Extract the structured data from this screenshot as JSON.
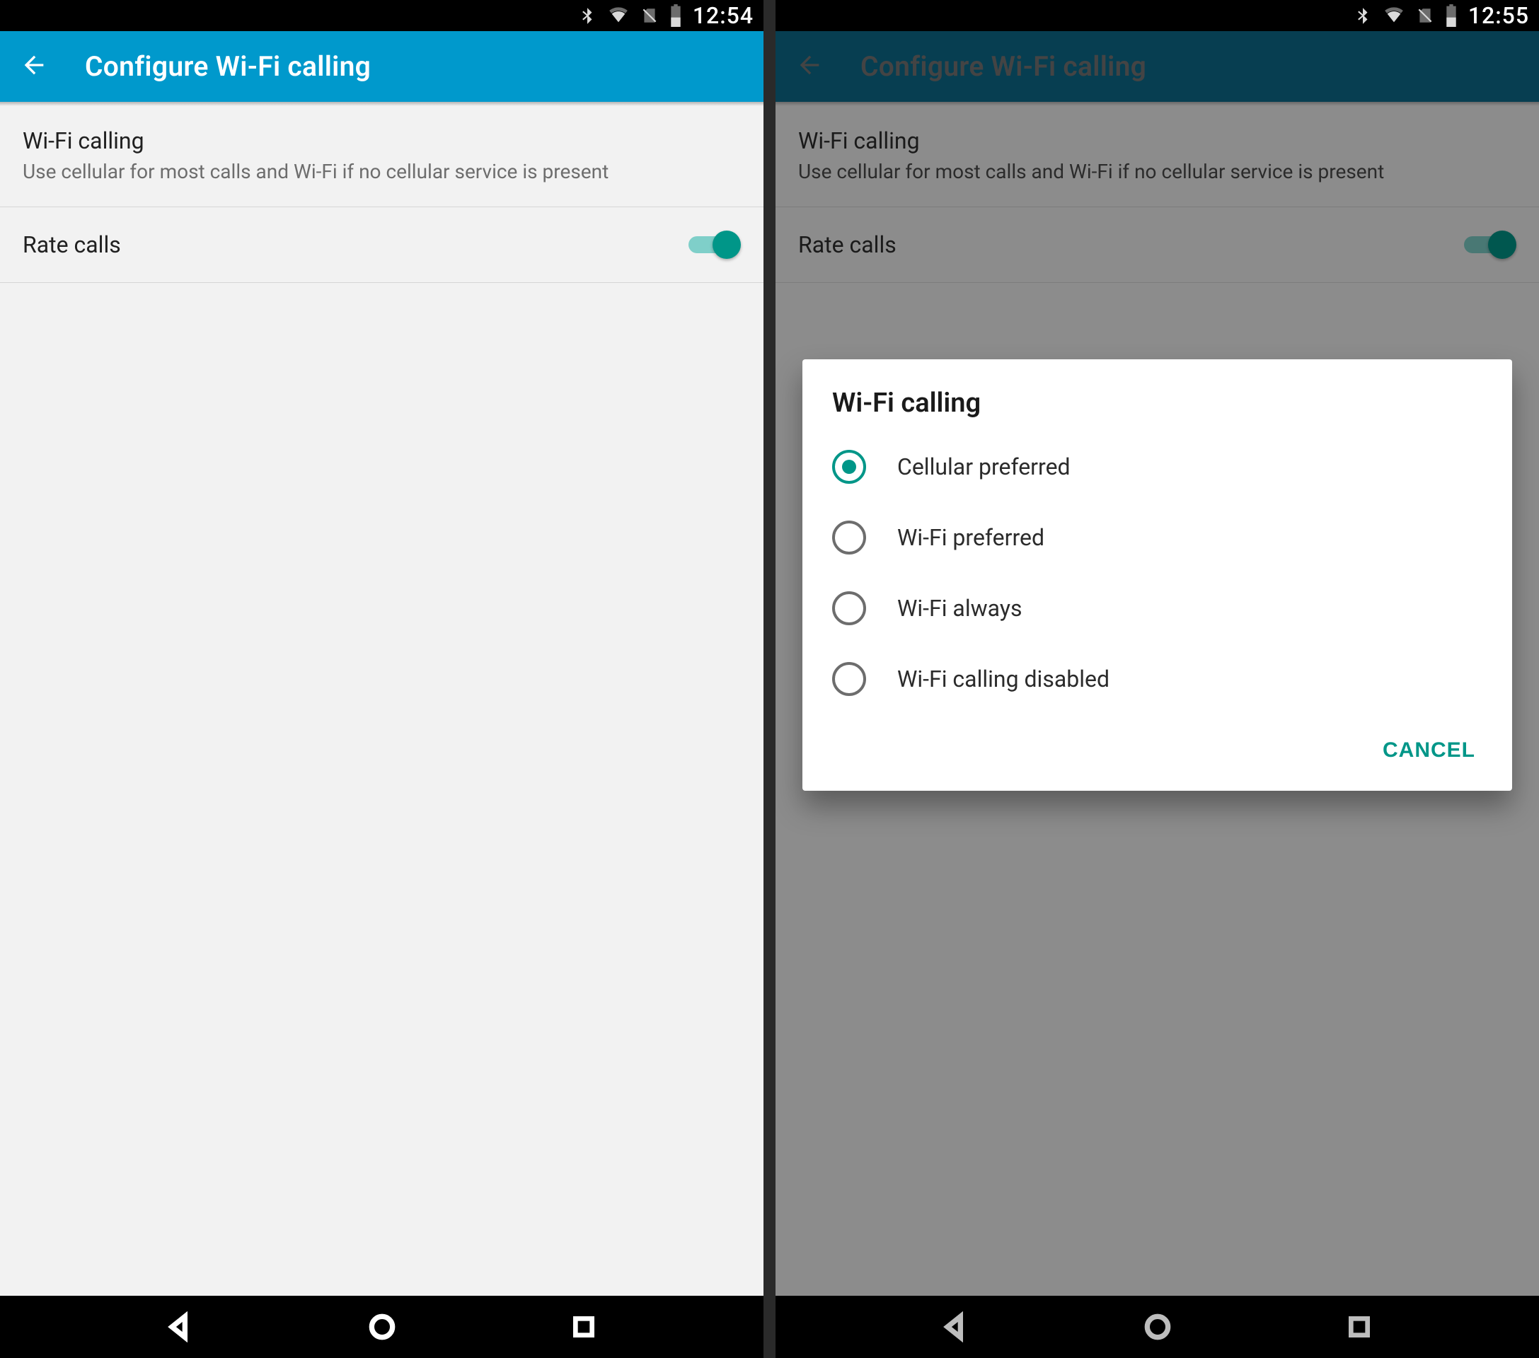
{
  "status": {
    "left": {
      "time": "12:54"
    },
    "right": {
      "time": "12:55"
    },
    "icons": {
      "bluetooth": "bluetooth-icon",
      "wifi": "wifi-icon",
      "nosim": "no-sim-icon",
      "battery": "battery-icon"
    }
  },
  "appbar": {
    "title": "Configure Wi-Fi calling",
    "back_icon": "arrow-back-icon"
  },
  "settings": {
    "wifi_calling": {
      "title": "Wi-Fi calling",
      "summary": "Use cellular for most calls and Wi-Fi if no cellular service is present"
    },
    "rate_calls": {
      "title": "Rate calls",
      "enabled": true
    }
  },
  "dialog": {
    "title": "Wi-Fi calling",
    "options": [
      {
        "label": "Cellular preferred",
        "selected": true
      },
      {
        "label": "Wi-Fi preferred",
        "selected": false
      },
      {
        "label": "Wi-Fi always",
        "selected": false
      },
      {
        "label": "Wi-Fi calling disabled",
        "selected": false
      }
    ],
    "cancel_label": "CANCEL"
  },
  "navbar": {
    "back": "nav-back-icon",
    "home": "nav-home-icon",
    "recent": "nav-recent-icon"
  },
  "colors": {
    "accent": "#009688",
    "appbar": "#0099cc"
  }
}
